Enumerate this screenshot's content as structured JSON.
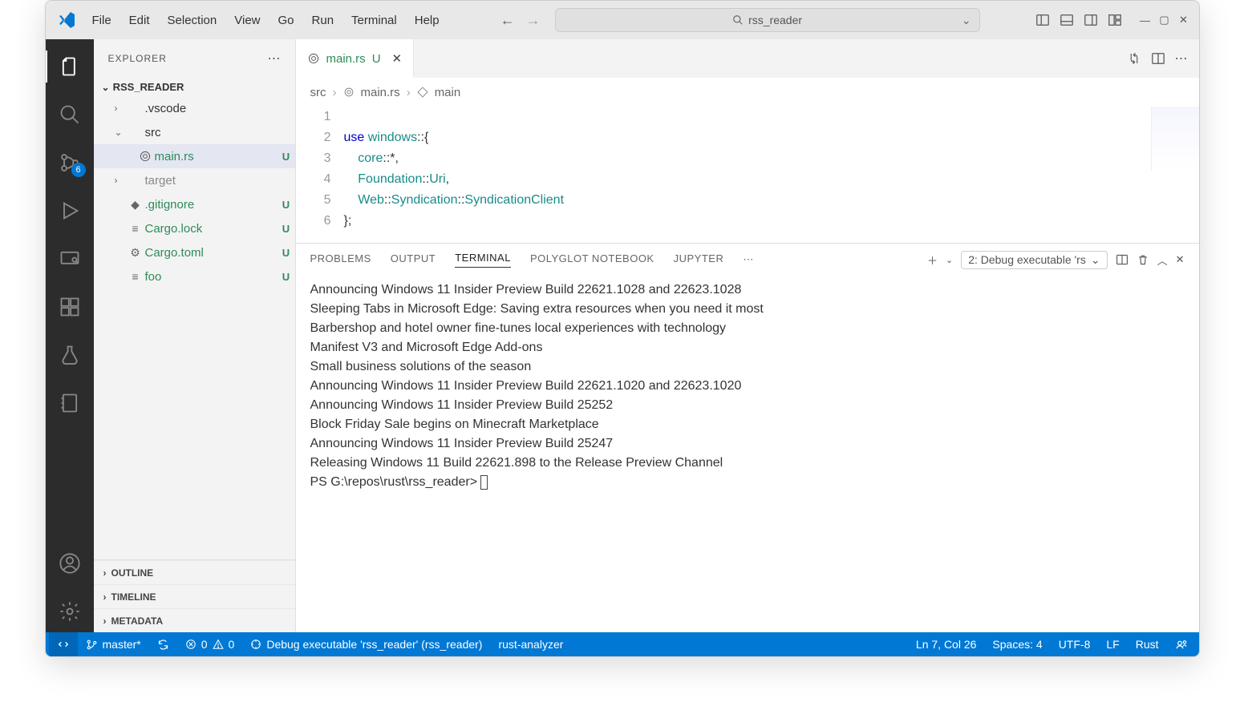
{
  "menu": {
    "items": [
      "File",
      "Edit",
      "Selection",
      "View",
      "Go",
      "Run",
      "Terminal",
      "Help"
    ]
  },
  "search": {
    "text": "rss_reader"
  },
  "activity": {
    "badge": "6"
  },
  "explorer": {
    "title": "EXPLORER",
    "root": "RSS_READER",
    "tree": [
      {
        "label": ".vscode",
        "chev": "›",
        "status": "",
        "dot": true,
        "indent": 1,
        "icon": ""
      },
      {
        "label": "src",
        "chev": "⌄",
        "status": "",
        "dot": true,
        "indent": 1,
        "icon": ""
      },
      {
        "label": "main.rs",
        "chev": "",
        "status": "U",
        "dot": false,
        "indent": 2,
        "icon": "rust",
        "selected": true
      },
      {
        "label": "target",
        "chev": "›",
        "status": "",
        "dot": false,
        "indent": 1,
        "icon": ""
      },
      {
        "label": ".gitignore",
        "chev": "",
        "status": "U",
        "dot": false,
        "indent": 1,
        "icon": "git"
      },
      {
        "label": "Cargo.lock",
        "chev": "",
        "status": "U",
        "dot": false,
        "indent": 1,
        "icon": "file"
      },
      {
        "label": "Cargo.toml",
        "chev": "",
        "status": "U",
        "dot": false,
        "indent": 1,
        "icon": "gear"
      },
      {
        "label": "foo",
        "chev": "",
        "status": "U",
        "dot": false,
        "indent": 1,
        "icon": "file"
      }
    ],
    "sections": [
      "OUTLINE",
      "TIMELINE",
      "METADATA"
    ]
  },
  "tab": {
    "filename": "main.rs",
    "modified": "U"
  },
  "breadcrumb": {
    "p1": "src",
    "p2": "main.rs",
    "p3": "main"
  },
  "code": {
    "lines": [
      "1",
      "2",
      "3",
      "4",
      "5",
      "6"
    ],
    "l1a": "use ",
    "l1b": "windows",
    "l1c": "::{",
    "l2a": "    core",
    "l2b": "::*,",
    "l3a": "    Foundation",
    "l3b": "::",
    "l3c": "Uri",
    "l3d": ",",
    "l4a": "    Web",
    "l4b": "::",
    "l4c": "Syndication",
    "l4d": "::",
    "l4e": "SyndicationClient",
    "l5": "};",
    "l6": ""
  },
  "panel": {
    "tabs": [
      "PROBLEMS",
      "OUTPUT",
      "TERMINAL",
      "POLYGLOT NOTEBOOK",
      "JUPYTER"
    ],
    "active": 2,
    "task_label": "2: Debug executable 'rs"
  },
  "terminal": {
    "lines": [
      "Announcing Windows 11 Insider Preview Build 22621.1028 and 22623.1028",
      "Sleeping Tabs in Microsoft Edge: Saving extra resources when you need it most",
      "Barbershop and hotel owner fine-tunes local experiences with technology",
      "Manifest V3 and Microsoft Edge Add-ons",
      "Small business solutions of the season",
      "Announcing Windows 11 Insider Preview Build 22621.1020 and 22623.1020",
      "Announcing Windows 11 Insider Preview Build 25252",
      "Block Friday Sale begins on Minecraft Marketplace",
      "Announcing Windows 11 Insider Preview Build 25247",
      "Releasing Windows 11 Build 22621.898 to the Release Preview Channel"
    ],
    "prompt": "PS G:\\repos\\rust\\rss_reader>"
  },
  "status": {
    "branch": "master*",
    "errors": "0",
    "warnings": "0",
    "debug": "Debug executable 'rss_reader' (rss_reader)",
    "analyzer": "rust-analyzer",
    "pos": "Ln 7, Col 26",
    "spaces": "Spaces: 4",
    "encoding": "UTF-8",
    "eol": "LF",
    "lang": "Rust"
  }
}
